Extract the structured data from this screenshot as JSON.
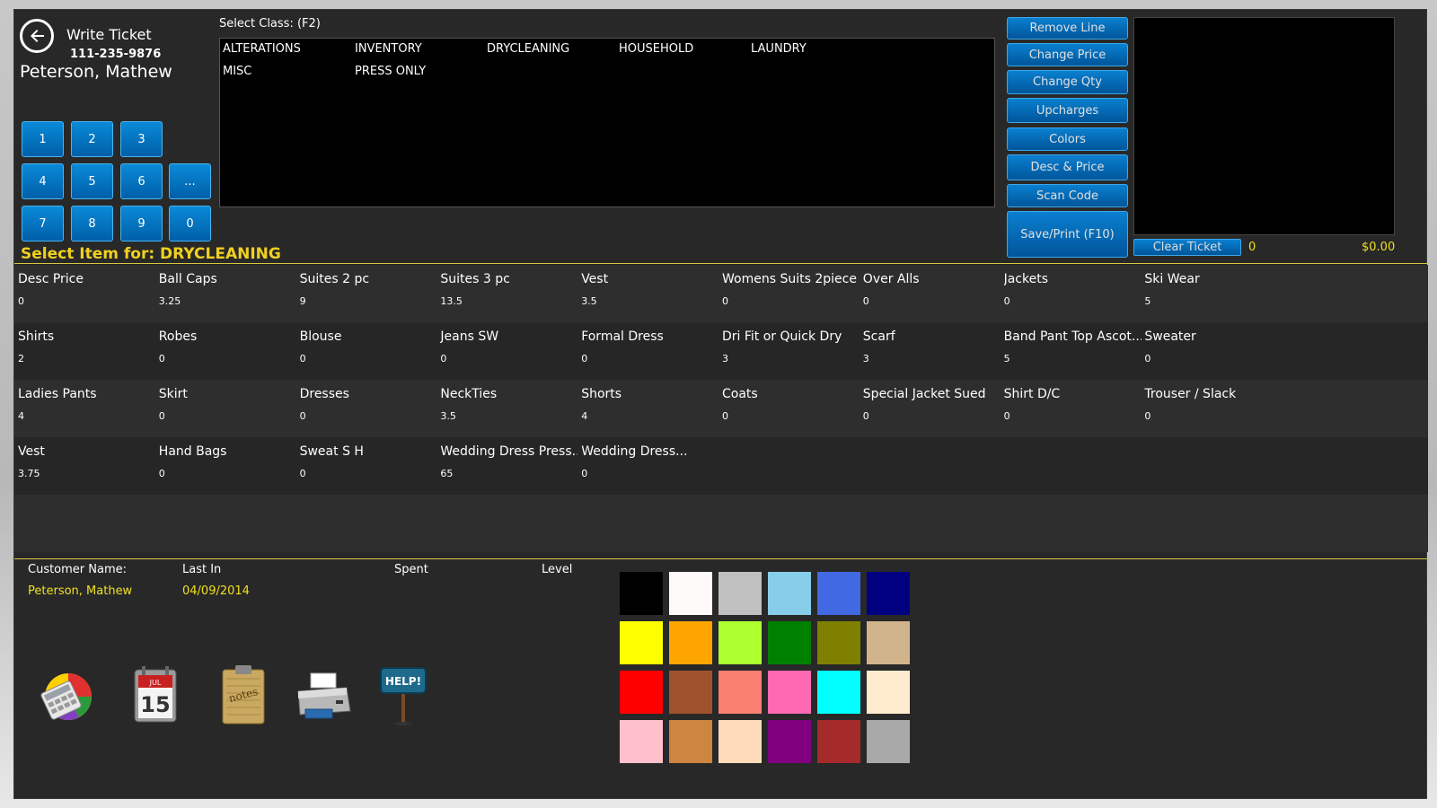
{
  "header": {
    "title": "Write Ticket",
    "phone": "111-235-9876",
    "customer_name": "Peterson, Mathew"
  },
  "numpad": [
    "1",
    "2",
    "3",
    "4",
    "5",
    "6",
    "...",
    "7",
    "8",
    "9",
    "0"
  ],
  "class_selector": {
    "label": "Select Class: (F2)",
    "classes": [
      "ALTERATIONS",
      "INVENTORY",
      "DRYCLEANING",
      "HOUSEHOLD",
      "LAUNDRY",
      "MISC",
      "PRESS ONLY"
    ]
  },
  "actions": {
    "remove_line": "Remove Line",
    "change_price": "Change Price",
    "change_qty": "Change Qty",
    "upcharges": "Upcharges",
    "colors": "Colors",
    "desc_price": "Desc & Price",
    "scan_code": "Scan Code",
    "save_print": "Save/Print (F10)"
  },
  "ticket": {
    "clear_label": "Clear Ticket",
    "count": "0",
    "total": "$0.00"
  },
  "select_item_label": "Select Item for: DRYCLEANING",
  "items": [
    {
      "name": "Desc  Price",
      "price": "0"
    },
    {
      "name": "Ball Caps",
      "price": "3.25"
    },
    {
      "name": "Suites 2 pc",
      "price": "9"
    },
    {
      "name": "Suites 3 pc",
      "price": "13.5"
    },
    {
      "name": "Vest",
      "price": "3.5"
    },
    {
      "name": "Womens Suits 2piece",
      "price": "0"
    },
    {
      "name": "Over Alls",
      "price": "0"
    },
    {
      "name": "Jackets",
      "price": "0"
    },
    {
      "name": "Ski Wear",
      "price": "5"
    },
    {
      "name": "Shirts",
      "price": "2"
    },
    {
      "name": "Robes",
      "price": "0"
    },
    {
      "name": "Blouse",
      "price": "0"
    },
    {
      "name": "Jeans  SW",
      "price": "0"
    },
    {
      "name": "Formal  Dress",
      "price": "0"
    },
    {
      "name": "Dri Fit or Quick Dry",
      "price": "3"
    },
    {
      "name": "Scarf",
      "price": "3"
    },
    {
      "name": "Band Pant Top Ascot...",
      "price": "5"
    },
    {
      "name": "Sweater",
      "price": "0"
    },
    {
      "name": "Ladies Pants",
      "price": "4"
    },
    {
      "name": "Skirt",
      "price": "0"
    },
    {
      "name": "Dresses",
      "price": "0"
    },
    {
      "name": "NeckTies",
      "price": "3.5"
    },
    {
      "name": "Shorts",
      "price": "4"
    },
    {
      "name": "Coats",
      "price": "0"
    },
    {
      "name": "Special Jacket Sued",
      "price": "0"
    },
    {
      "name": "Shirt D/C",
      "price": "0"
    },
    {
      "name": "Trouser / Slack",
      "price": "0"
    },
    {
      "name": "Vest",
      "price": "3.75"
    },
    {
      "name": "Hand Bags",
      "price": "0"
    },
    {
      "name": "Sweat S H",
      "price": "0"
    },
    {
      "name": "Wedding Dress Press...",
      "price": "65"
    },
    {
      "name": "Wedding Dress...",
      "price": "0"
    }
  ],
  "customer_info": {
    "name_label": "Customer Name:",
    "name_value": "Peterson, Mathew",
    "last_in_label": "Last In",
    "last_in_value": "04/09/2014",
    "spent_label": "Spent",
    "level_label": "Level"
  },
  "tools": [
    "calculator-icon",
    "calendar-icon",
    "notes-icon",
    "printer-icon",
    "help-sign-icon"
  ],
  "calendar_day": "15",
  "calendar_month": "JUL",
  "notes_text": "notes",
  "help_text": "HELP!",
  "color_swatches": [
    "#000000",
    "#fffafa",
    "#c0c0c0",
    "#87ceeb",
    "#4169e1",
    "#000080",
    "#ffff00",
    "#ffa500",
    "#adff2f",
    "#008000",
    "#808000",
    "#d2b48c",
    "#ff0000",
    "#a0522d",
    "#fa8072",
    "#ff69b4",
    "#00ffff",
    "#ffebcd",
    "#ffc0cb",
    "#cd853f",
    "#ffdab9",
    "#800080",
    "#a52a2a",
    "#a9a9a9"
  ]
}
